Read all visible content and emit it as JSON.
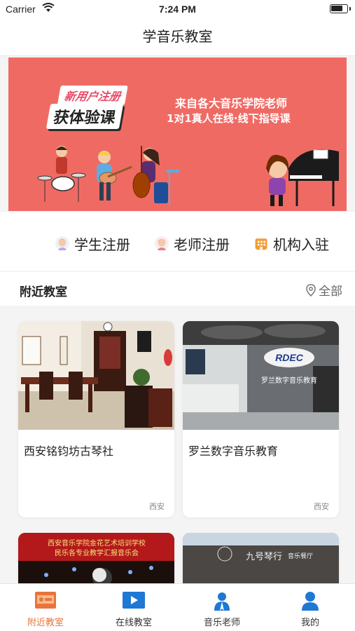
{
  "status_bar": {
    "carrier": "Carrier",
    "time": "7:24 PM"
  },
  "nav": {
    "title": "学音乐教室"
  },
  "banner": {
    "badge_top": "新用户注册",
    "badge_main": "获体验课",
    "line1": "来自各大音乐学院老师",
    "line2": "1对1真人在线·线下指导课",
    "background_color": "#f06a64"
  },
  "quick_links": [
    {
      "label": "学生注册",
      "icon": "student-avatar-icon"
    },
    {
      "label": "老师注册",
      "icon": "teacher-avatar-icon"
    },
    {
      "label": "机构入驻",
      "icon": "building-icon"
    }
  ],
  "section": {
    "title": "附近教室",
    "all_label": "全部",
    "all_icon": "location-pin-icon"
  },
  "classrooms": [
    {
      "name": "西安铭钧坊古琴社",
      "city": "西安"
    },
    {
      "name": "罗兰数字音乐教育",
      "city": "西安",
      "photo_logo": "RDEC",
      "photo_caption": "罗兰数字音乐教育"
    },
    {
      "name": "",
      "city": "",
      "photo_caption_1": "西安音乐学院金花艺术培训学校",
      "photo_caption_2": "民乐各专业教学汇报音乐会"
    },
    {
      "name": "",
      "city": "",
      "photo_sign": "九号琴行",
      "photo_sign_2": "音乐餐厅"
    }
  ],
  "tabs": [
    {
      "label": "附近教室",
      "icon": "nearby-classroom-icon",
      "active": true
    },
    {
      "label": "在线教室",
      "icon": "play-video-icon",
      "active": false
    },
    {
      "label": "音乐老师",
      "icon": "teacher-icon",
      "active": false
    },
    {
      "label": "我的",
      "icon": "profile-icon",
      "active": false
    }
  ],
  "colors": {
    "accent": "#e8743a",
    "banner": "#f06a64",
    "tab_blue": "#1e78d4"
  }
}
